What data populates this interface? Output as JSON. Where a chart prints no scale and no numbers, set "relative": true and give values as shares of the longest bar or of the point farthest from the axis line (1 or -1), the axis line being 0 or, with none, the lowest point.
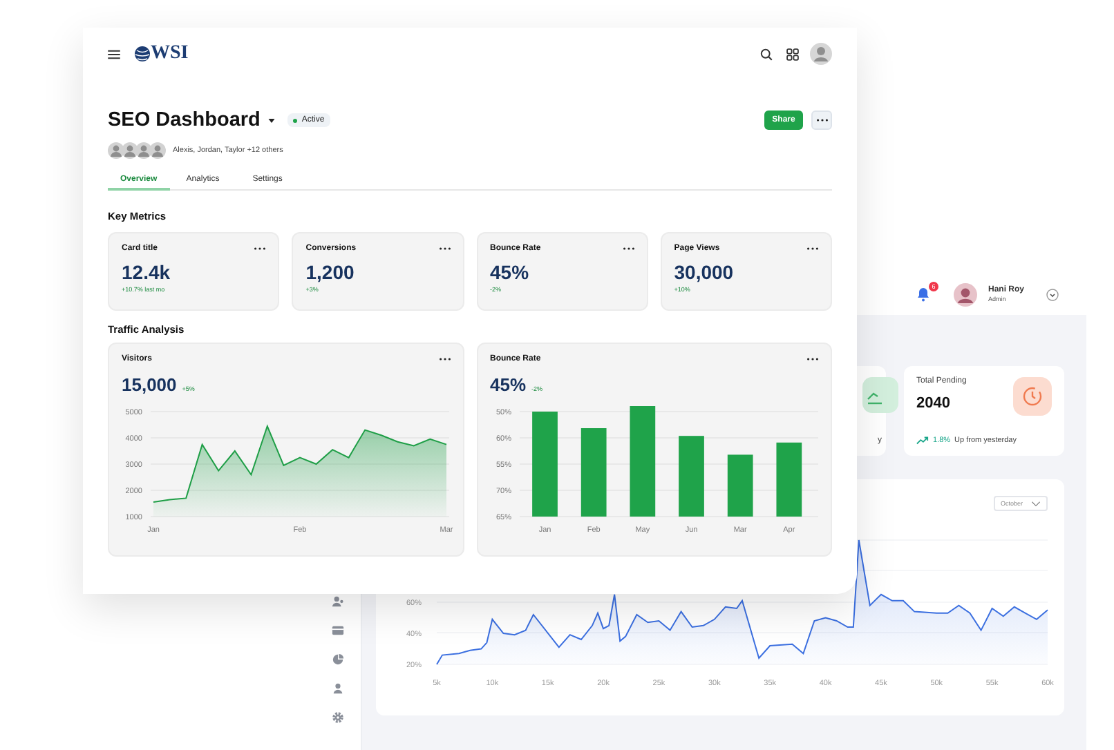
{
  "back_window": {
    "header": {
      "notification_count": "6",
      "user_name": "Hani Roy",
      "user_role": "Admin"
    },
    "cards": [
      {
        "kind": "partial",
        "text": "y"
      },
      {
        "kind": "stat",
        "title": "Total Pending",
        "value": "2040",
        "change": "1.8%",
        "change_text": "Up from yesterday"
      }
    ],
    "chart": {
      "dropdown": "October",
      "chart_data": {
        "type": "area",
        "x": [
          5,
          5.5,
          7,
          8,
          9,
          9.5,
          10,
          11,
          12,
          13,
          13.7,
          16,
          17,
          18,
          19,
          19.5,
          20,
          20.5,
          21,
          21.5,
          22,
          23,
          24,
          25,
          26,
          27,
          28,
          29,
          30,
          31,
          32,
          32.5,
          34,
          35,
          37,
          38,
          39,
          40,
          41,
          42,
          42.5,
          43,
          44,
          45,
          46,
          47,
          48,
          50,
          51,
          52,
          53,
          54,
          55,
          56,
          57,
          58,
          59,
          60
        ],
        "xlim": [
          5,
          60
        ],
        "ylim": [
          20,
          100
        ],
        "series": [
          {
            "color": "#3b6fe0",
            "values": [
              20,
              26,
              27,
              29,
              30,
              34,
              49,
              40,
              39,
              42,
              52,
              31,
              39,
              36,
              45,
              53,
              43,
              45,
              65,
              35,
              38,
              52,
              47,
              48,
              42,
              54,
              44,
              45,
              49,
              57,
              56,
              61,
              24,
              32,
              33,
              27,
              48,
              50,
              48,
              44,
              44,
              100,
              58,
              65,
              61,
              61,
              54,
              53,
              53,
              58,
              53,
              42,
              56,
              51,
              57,
              53,
              49,
              55
            ]
          }
        ],
        "yticks": [
          {
            "value": 20,
            "label": "20%"
          },
          {
            "value": 40,
            "label": "40%"
          },
          {
            "value": 60,
            "label": "60%"
          }
        ],
        "xticks": [
          {
            "value": 5,
            "label": "5k"
          },
          {
            "value": 10,
            "label": "10k"
          },
          {
            "value": 15,
            "label": "15k"
          },
          {
            "value": 20,
            "label": "20k"
          },
          {
            "value": 25,
            "label": "25k"
          },
          {
            "value": 30,
            "label": "30k"
          },
          {
            "value": 35,
            "label": "35k"
          },
          {
            "value": 40,
            "label": "40k"
          },
          {
            "value": 45,
            "label": "45k"
          },
          {
            "value": 50,
            "label": "50k"
          },
          {
            "value": 55,
            "label": "55k"
          },
          {
            "value": 60,
            "label": "60k"
          }
        ]
      }
    }
  },
  "front_window": {
    "logo": "WSI",
    "title": "SEO Dashboard",
    "status": "Active",
    "collaborators": "Alexis, Jordan, Taylor +12 others",
    "share_button": "Share",
    "tabs": [
      {
        "label": "Overview",
        "selected": true
      },
      {
        "label": "Analytics",
        "selected": false
      },
      {
        "label": "Settings",
        "selected": false
      }
    ],
    "key_metrics_heading": "Key Metrics",
    "metrics": [
      {
        "title": "Card title",
        "value": "12.4k",
        "change": "+10.7% last mo"
      },
      {
        "title": "Conversions",
        "value": "1,200",
        "change": "+3%"
      },
      {
        "title": "Bounce Rate",
        "value": "45%",
        "change": "-2%"
      },
      {
        "title": "Page Views",
        "value": "30,000",
        "change": "+10%"
      }
    ],
    "traffic_heading": "Traffic Analysis",
    "charts": [
      {
        "title": "Visitors",
        "value": "15,000",
        "change": "+5%",
        "chart_data": {
          "type": "area",
          "categories": [
            "Jan",
            null,
            null,
            null,
            null,
            null,
            null,
            null,
            null,
            "Feb",
            null,
            null,
            null,
            null,
            null,
            null,
            null,
            null,
            "Mar"
          ],
          "series": [
            {
              "color": "#1e9e46",
              "values": [
                1550,
                1650,
                1700,
                3750,
                2750,
                3500,
                2600,
                4450,
                2950,
                3250,
                3000,
                3550,
                3250,
                4300,
                4100,
                3850,
                3700,
                3950,
                3750
              ]
            }
          ],
          "ylim": [
            1000,
            5000
          ],
          "yticks": [
            1000,
            2000,
            3000,
            4000,
            5000
          ],
          "grid": true
        }
      },
      {
        "title": "Bounce Rate",
        "value": "45%",
        "change": "-2%",
        "chart_data": {
          "type": "bar",
          "categories": [
            "Jan",
            "Feb",
            "May",
            "Jun",
            "Mar",
            "Apr"
          ],
          "relative": true,
          "grid": true,
          "series": [
            {
              "color": "#1fa34a",
              "values": [
                0.95,
                0.8,
                1,
                0.73,
                0.56,
                0.67
              ]
            }
          ],
          "annotations": [
            {
              "text": "50%"
            },
            {
              "text": "60%"
            },
            {
              "text": "55%"
            },
            {
              "text": "70%"
            },
            {
              "text": "65%"
            }
          ]
        }
      }
    ]
  }
}
